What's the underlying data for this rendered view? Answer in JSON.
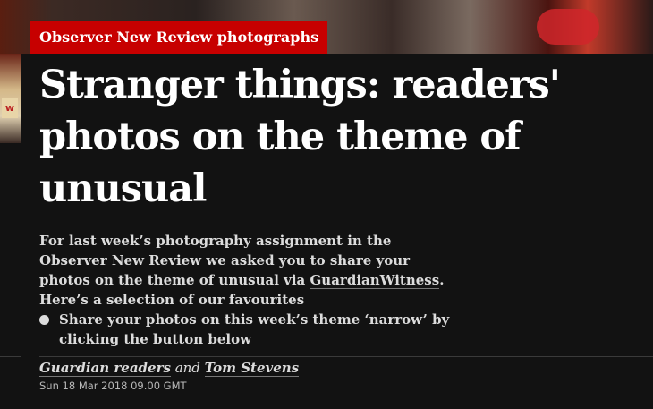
{
  "kicker": "Observer New Review photographs",
  "headline": "Stranger things: readers' photos on the theme of unusual",
  "standfirst": {
    "text_before": "For last week’s photography assignment in the Observer New Review we asked you to share your photos on the theme of unusual via ",
    "link_text": "GuardianWitness",
    "text_after": ". Here’s a selection of our favourites"
  },
  "bullet": {
    "text": "Share your photos on this week’s theme ‘narrow’ by clicking the button below"
  },
  "byline": {
    "author1": "Guardian readers",
    "joiner": " and ",
    "author2": "Tom Stevens"
  },
  "dateline": "Sun 18 Mar 2018 09.00 GMT",
  "colors": {
    "background": "#121212",
    "kicker_background": "#c70000",
    "text": "#ffffff"
  }
}
